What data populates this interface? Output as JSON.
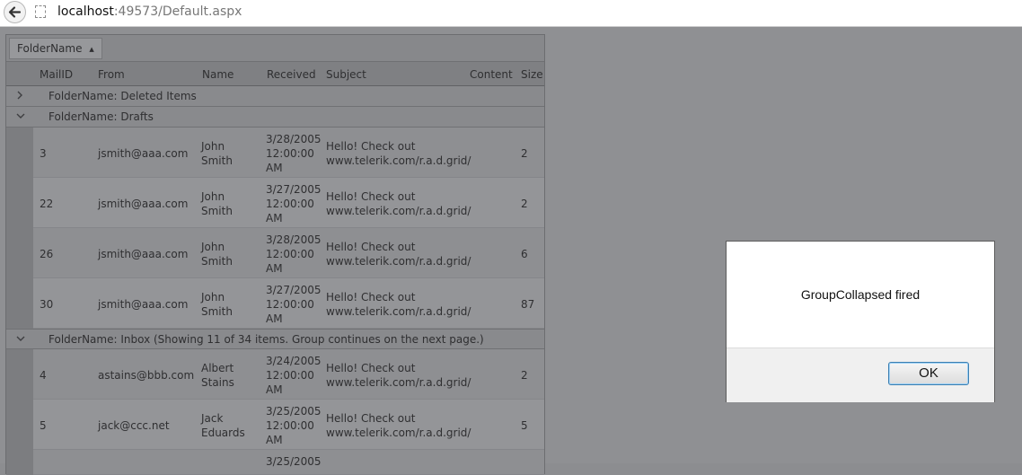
{
  "browser": {
    "url_host": "localhost",
    "url_rest": ":49573/Default.aspx",
    "back_icon": "arrow-left-icon",
    "page_icon": "page-icon"
  },
  "grid": {
    "group_chip": {
      "label": "FolderName",
      "sort_arrow": "▲"
    },
    "columns": [
      "MailID",
      "From",
      "Name",
      "Received",
      "Subject",
      "Content",
      "Size"
    ],
    "groups": [
      {
        "title": "FolderName: Deleted Items",
        "expanded": false
      },
      {
        "title": "FolderName: Drafts",
        "expanded": true
      },
      {
        "title": "FolderName: Inbox (Showing 11 of 34 items. Group continues on the next page.)",
        "expanded": true
      }
    ],
    "drafts_rows": [
      {
        "id": "3",
        "from": "jsmith@aaa.com",
        "name": "John Smith",
        "received": "3/28/2005 12:00:00 AM",
        "subject": "Hello! Check out www.telerik.com/r.a.d.grid/",
        "size": "2"
      },
      {
        "id": "22",
        "from": "jsmith@aaa.com",
        "name": "John Smith",
        "received": "3/27/2005 12:00:00 AM",
        "subject": "Hello! Check out www.telerik.com/r.a.d.grid/",
        "size": "2"
      },
      {
        "id": "26",
        "from": "jsmith@aaa.com",
        "name": "John Smith",
        "received": "3/28/2005 12:00:00 AM",
        "subject": "Hello! Check out www.telerik.com/r.a.d.grid/",
        "size": "6"
      },
      {
        "id": "30",
        "from": "jsmith@aaa.com",
        "name": "John Smith",
        "received": "3/27/2005 12:00:00 AM",
        "subject": "Hello! Check out www.telerik.com/r.a.d.grid/",
        "size": "87"
      }
    ],
    "inbox_rows": [
      {
        "id": "4",
        "from": "astains@bbb.com",
        "name": "Albert Stains",
        "received": "3/24/2005 12:00:00 AM",
        "subject": "Hello! Check out www.telerik.com/r.a.d.grid/",
        "size": "2"
      },
      {
        "id": "5",
        "from": "jack@ccc.net",
        "name": "Jack Eduards",
        "received": "3/25/2005 12:00:00 AM",
        "subject": "Hello! Check out www.telerik.com/r.a.d.grid/",
        "size": "5"
      },
      {
        "id": "",
        "from": "",
        "name": "",
        "received": "3/25/2005",
        "subject": "",
        "size": ""
      }
    ]
  },
  "dialog": {
    "message": "GroupCollapsed fired",
    "ok_label": "OK"
  }
}
